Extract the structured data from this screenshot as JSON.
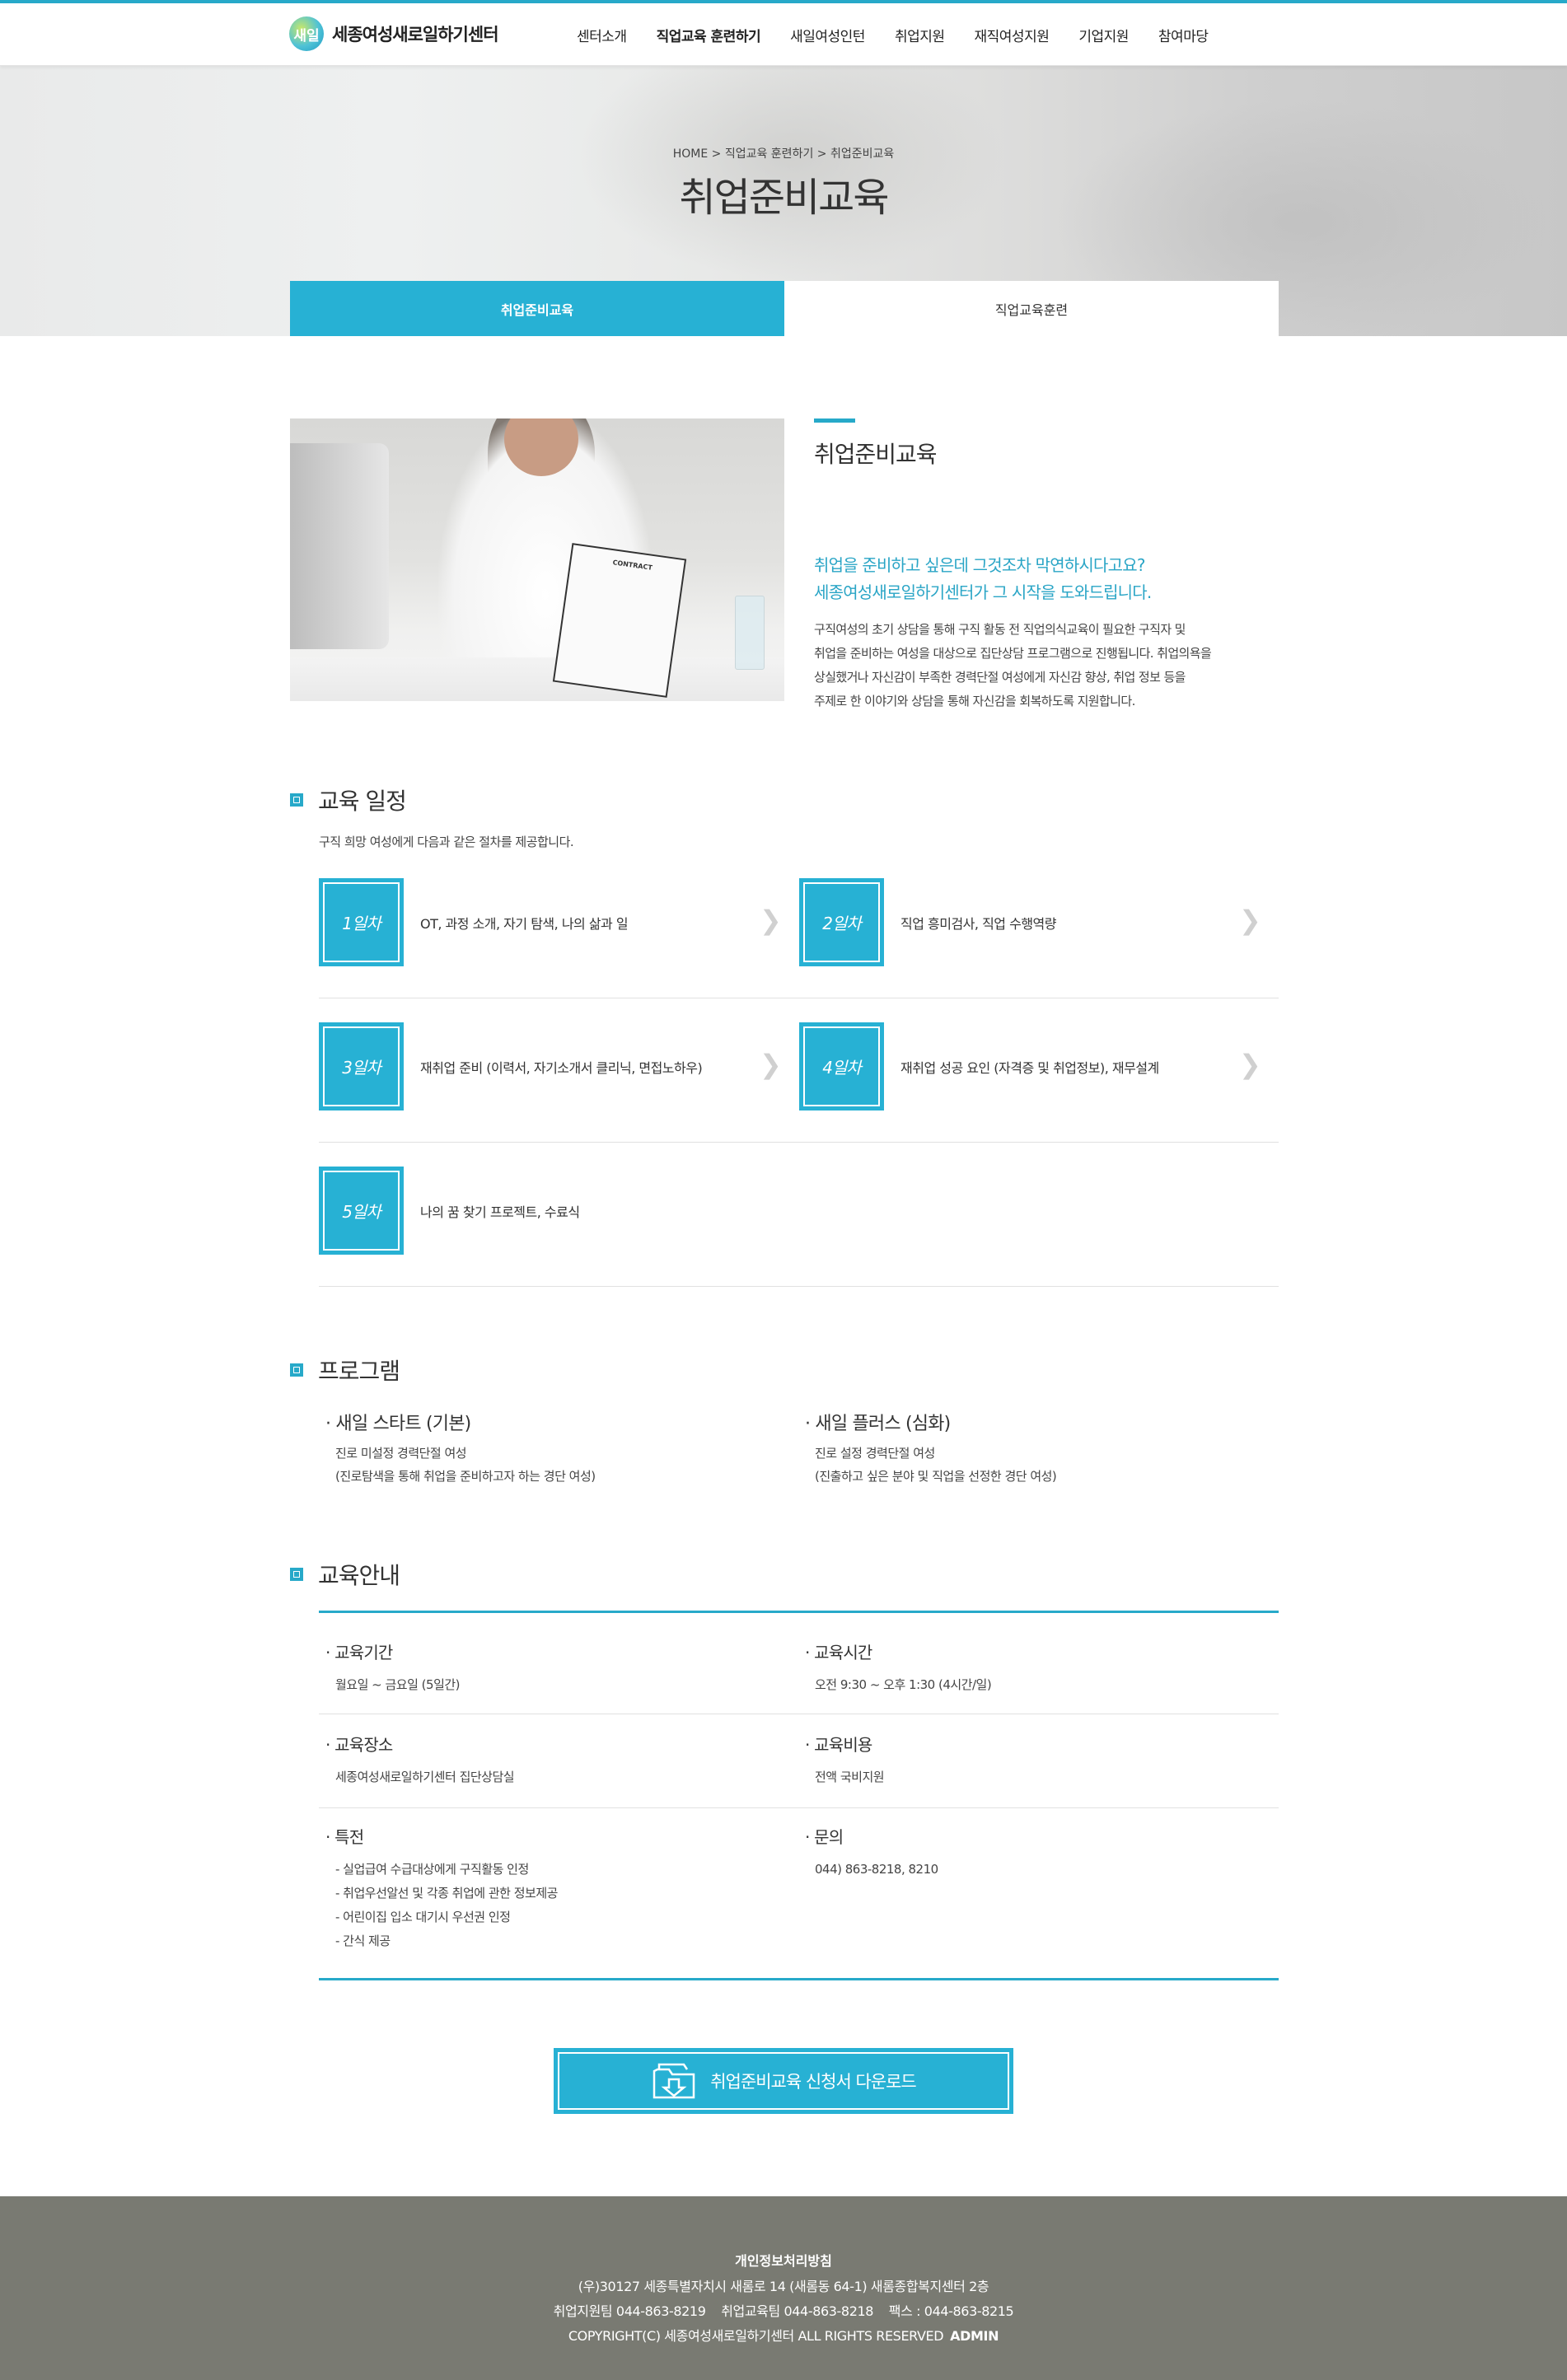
{
  "header": {
    "logo_mark": "새일",
    "logo_text": "세종여성새로일하기센터",
    "nav": [
      "센터소개",
      "직업교육 훈련하기",
      "새일여성인턴",
      "취업지원",
      "재직여성지원",
      "기업지원",
      "참여마당"
    ]
  },
  "hero": {
    "breadcrumb": "HOME > 직업교육 훈련하기 > 취업준비교육",
    "title": "취업준비교육"
  },
  "tabs": [
    {
      "label": "취업준비교육",
      "active": true
    },
    {
      "label": "직업교육훈련",
      "active": false
    }
  ],
  "intro": {
    "image_contract_text": "CONTRACT",
    "title": "취업준비교육",
    "lead_1": "취업을 준비하고 싶은데 그것조차 막연하시다고요?",
    "lead_2": "세종여성새로일하기센터가 그 시작을 도와드립니다.",
    "body_1": "구직여성의 초기 상담을 통해 구직 활동 전 직업의식교육이 필요한 구직자 및",
    "body_2": "취업을 준비하는 여성을 대상으로 집단상담 프로그램으로 진행됩니다. 취업의욕을",
    "body_3": "상실했거나 자신감이 부족한 경력단절 여성에게 자신감 향상, 취업 정보 등을",
    "body_4": "주제로 한 이야기와 상담을 통해 자신감을 회복하도록 지원합니다."
  },
  "schedule": {
    "title": "교육 일정",
    "desc": "구직 희망 여성에게 다음과 같은 절차를 제공합니다.",
    "days": [
      {
        "day": "1일차",
        "text": "OT, 과정 소개, 자기 탐색, 나의 삶과 일"
      },
      {
        "day": "2일차",
        "text": "직업 흥미검사, 직업 수행역량"
      },
      {
        "day": "3일차",
        "text": "재취업 준비 (이력서, 자기소개서 클리닉, 면접노하우)"
      },
      {
        "day": "4일차",
        "text": "재취업 성공 요인 (자격증 및 취업정보), 재무설계"
      },
      {
        "day": "5일차",
        "text": "나의 꿈 찾기 프로젝트, 수료식"
      }
    ],
    "arrow": "❯"
  },
  "programs": {
    "title": "프로그램",
    "items": [
      {
        "name": "· 새일 스타트 (기본)",
        "line1": "진로 미설정 경력단절 여성",
        "line2": "(진로탐색을 통해 취업을 준비하고자 하는 경단 여성)"
      },
      {
        "name": "· 새일 플러스 (심화)",
        "line1": "진로 설정 경력단절 여성",
        "line2": "(진출하고 싶은 분야 및 직업을 선정한 경단 여성)"
      }
    ]
  },
  "guide": {
    "title": "교육안내",
    "period_label": "· 교육기간",
    "period_value": "월요일 ~ 금요일 (5일간)",
    "time_label": "· 교육시간",
    "time_value": "오전 9:30 ~ 오후 1:30 (4시간/일)",
    "place_label": "· 교육장소",
    "place_value": "세종여성새로일하기센터 집단상담실",
    "cost_label": "· 교육비용",
    "cost_value": "전액 국비지원",
    "benefit_label": "· 특전",
    "benefits": [
      "- 실업급여 수급대상에게 구직활동 인정",
      "- 취업우선알선 및 각종 취업에 관한 정보제공",
      "- 어린이집 입소 대기시 우선권 인정",
      "- 간식 제공"
    ],
    "contact_label": "· 문의",
    "contact_value": "044) 863-8218, 8210"
  },
  "download": {
    "label": "취업준비교육 신청서 다운로드"
  },
  "footer": {
    "title": "개인정보처리방침",
    "address": "(우)30127 세종특별자치시 새롬로 14 (새롬동 64-1) 새롬종합복지센터 2층",
    "phones": "취업지원팀 044-863-8219    취업교육팀 044-863-8218    팩스 : 044-863-8215",
    "copyright": "COPYRIGHT(C) 세종여성새로일하기센터 ALL RIGHTS RESERVED",
    "admin": "ADMIN"
  },
  "colors": {
    "accent": "#27b1d4",
    "footer_bg": "#797a72"
  }
}
